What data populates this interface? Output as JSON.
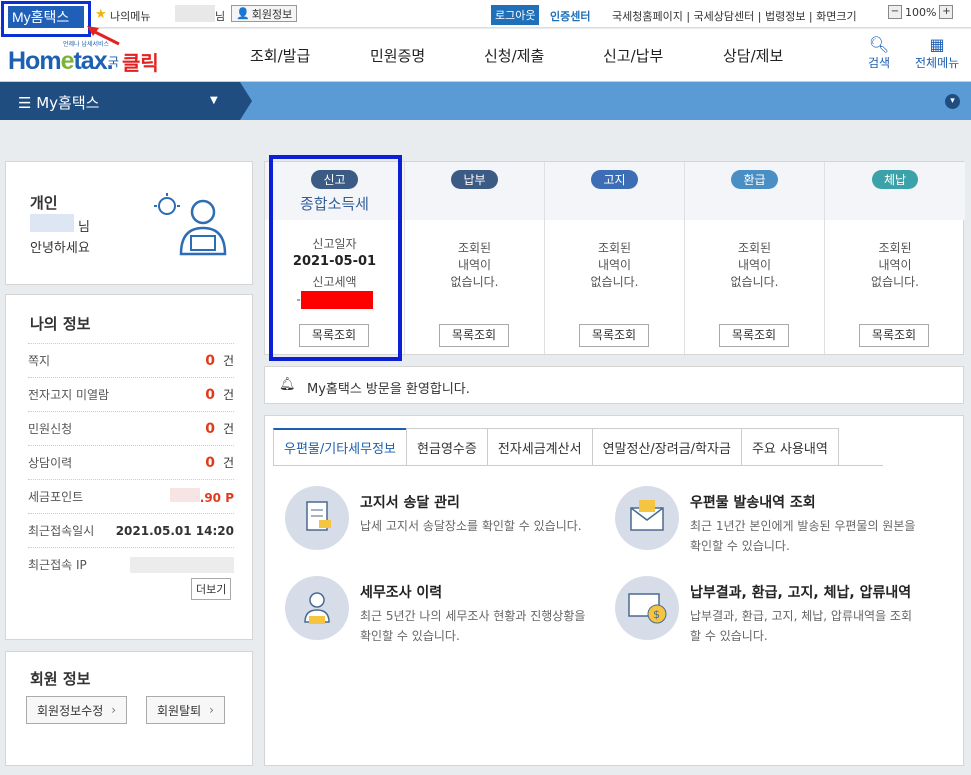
{
  "topbar": {
    "my_hometax_label": "My홈택스",
    "my_menu": "나의메뉴",
    "nim": "님",
    "member_info": "회원정보",
    "logout": "로그아웃",
    "cert_center": "인증센터",
    "links": "국세청홈페이지 | 국세상담센터 | 법령정보 | 화면크기",
    "zoom_minus": "−",
    "zoom_value": "100%",
    "zoom_plus": "+"
  },
  "header": {
    "logo_text": "Hometax",
    "logo_sub": "언제나 납세서비스",
    "logo_gukse": "국",
    "click_label": "클릭",
    "nav": [
      "조회/발급",
      "민원증명",
      "신청/제출",
      "신고/납부",
      "상담/제보"
    ],
    "search": "검색",
    "all_menu": "전체메뉴"
  },
  "strip": {
    "title": "My홈택스"
  },
  "personal": {
    "title": "개인",
    "nim": "님",
    "hello": "안녕하세요"
  },
  "myinfo": {
    "title": "나의 정보",
    "rows": [
      {
        "label": "쪽지",
        "count": "0",
        "unit": "건"
      },
      {
        "label": "전자고지 미열람",
        "count": "0",
        "unit": "건"
      },
      {
        "label": "민원신청",
        "count": "0",
        "unit": "건"
      },
      {
        "label": "상담이력",
        "count": "0",
        "unit": "건"
      }
    ],
    "points_label": "세금포인트",
    "points_value": ".90 P",
    "last_access_label": "최근접속일시",
    "last_access_value": "2021.05.01 14:20",
    "last_ip_label": "최근접속 IP",
    "more": "더보기"
  },
  "member": {
    "title": "회원 정보",
    "edit": "회원정보수정",
    "withdraw": "회원탈퇴"
  },
  "status": {
    "report": {
      "badge": "신고",
      "sub": "종합소득세",
      "date_label": "신고일자",
      "date": "2021-05-01",
      "tax_label": "신고세액",
      "dash": "-",
      "btn": "목록조회"
    },
    "pay": {
      "badge": "납부",
      "l1": "조회된",
      "l2": "내역이",
      "l3": "없습니다.",
      "btn": "목록조회"
    },
    "notice": {
      "badge": "고지",
      "l1": "조회된",
      "l2": "내역이",
      "l3": "없습니다.",
      "btn": "목록조회"
    },
    "refund": {
      "badge": "환급",
      "l1": "조회된",
      "l2": "내역이",
      "l3": "없습니다.",
      "btn": "목록조회"
    },
    "arrear": {
      "badge": "체납",
      "l1": "조회된",
      "l2": "내역이",
      "l3": "없습니다.",
      "btn": "목록조회"
    }
  },
  "welcome": {
    "text": "My홈택스 방문을 환영합니다."
  },
  "tabs": [
    "우편물/기타세무정보",
    "현금영수증",
    "전자세금계산서",
    "연말정산/장려금/학자금",
    "주요 사용내역"
  ],
  "services": [
    {
      "title": "고지서 송달 관리",
      "desc": "납세 고지서 송달장소를 확인할 수 있습니다."
    },
    {
      "title": "우편물 발송내역 조회",
      "desc": "최근 1년간 본인에게 발송된 우편물의 원본을 확인할 수 있습니다."
    },
    {
      "title": "세무조사 이력",
      "desc": "최근 5년간 나의 세무조사 현황과 진행상황을 확인할 수 있습니다."
    },
    {
      "title": "납부결과, 환급, 고지, 체납, 압류내역",
      "desc": "납부결과, 환급, 고지, 체납, 압류내역을 조회할 수 있습니다."
    }
  ]
}
